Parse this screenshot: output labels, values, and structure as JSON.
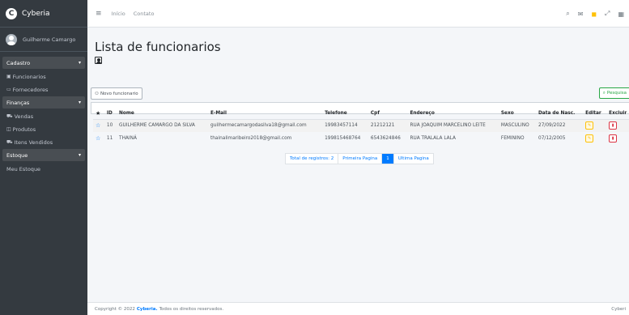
{
  "brand": {
    "name": "Cyberia",
    "logo_letter": "C"
  },
  "user": {
    "name": "Guilherme Camargo"
  },
  "sidebar": {
    "sections": [
      {
        "label": "Cadastro",
        "items": [
          {
            "label": "Funcionarios"
          },
          {
            "label": "Fornecedores"
          }
        ]
      },
      {
        "label": "Finanças",
        "items": [
          {
            "label": "Vendas"
          },
          {
            "label": "Produtos"
          },
          {
            "label": "Itens Vendidos"
          }
        ]
      },
      {
        "label": "Estoque",
        "items": [
          {
            "label": "Meu Estoque"
          }
        ]
      }
    ]
  },
  "topnav": {
    "links": [
      "Início",
      "Contato"
    ],
    "icons": [
      "search-icon",
      "comments-icon",
      "bell-icon",
      "expand-icon",
      "grid-icon"
    ],
    "badges": {
      "comments": "",
      "bell": ""
    }
  },
  "page": {
    "title": "Lista de funcionarios",
    "new_button": "Novo funcionario",
    "search_button": "Pesquisa"
  },
  "table": {
    "headers": [
      "ID",
      "Nome",
      "E-Mail",
      "Telefone",
      "Cpf",
      "Endereço",
      "Sexo",
      "Data de Nasc.",
      "Editar",
      "Excluir"
    ],
    "rows": [
      {
        "id": "10",
        "nome": "GUILHERME CAMARGO DA SILVA",
        "email": "guilhermecamargodasilva18@gmail.com",
        "telefone": "19983457114",
        "cpf": "21212121",
        "endereco": "RUA JOAQUIM MARCELINO LEITE",
        "sexo": "MASCULINO",
        "nasc": "27/09/2022"
      },
      {
        "id": "11",
        "nome": "THAINÁ",
        "email": "thainalimaribeiro2018@gmail.com",
        "telefone": "199815468764",
        "cpf": "6543624846",
        "endereco": "RUA TRALALA LALA",
        "sexo": "FEMININO",
        "nasc": "07/12/2005"
      }
    ]
  },
  "pagination": {
    "total": "Total de registros: 2",
    "first": "Primeira Pagina",
    "current": "1",
    "last": "Ultima Pagina"
  },
  "footer": {
    "prefix": "Copyright © 2022",
    "brand": "Cyberia.",
    "suffix": "Todos os direitos reservados.",
    "right": "Cyberi"
  },
  "colors": {
    "sidebar": "#343a40",
    "accent": "#007bff",
    "success": "#28a745",
    "warning": "#ffc107",
    "danger": "#dc3545"
  }
}
